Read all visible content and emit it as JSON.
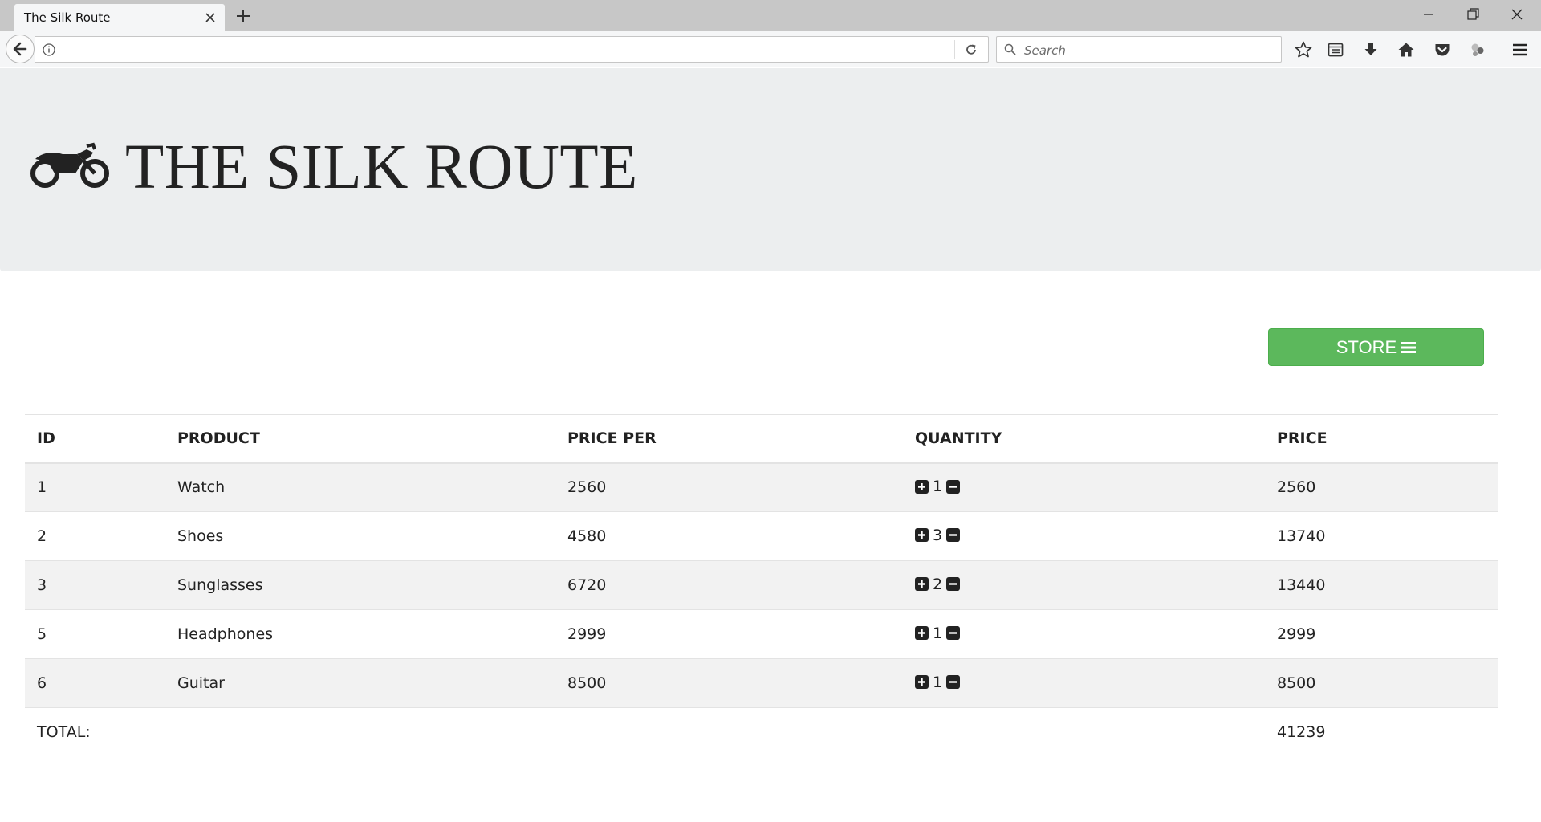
{
  "browser": {
    "tab_title": "The Silk Route",
    "url": "",
    "search_placeholder": "Search"
  },
  "header": {
    "brand_icon": "motorcycle-icon",
    "title": "THE SILK ROUTE"
  },
  "store_button": {
    "label": "STORE",
    "icon": "menu-icon",
    "color": "#5cb85c"
  },
  "cart": {
    "columns": [
      "ID",
      "PRODUCT",
      "PRICE PER",
      "QUANTITY",
      "PRICE"
    ],
    "rows": [
      {
        "id": "1",
        "product": "Watch",
        "price_per": "2560",
        "quantity": "1",
        "price": "2560"
      },
      {
        "id": "2",
        "product": "Shoes",
        "price_per": "4580",
        "quantity": "3",
        "price": "13740"
      },
      {
        "id": "3",
        "product": "Sunglasses",
        "price_per": "6720",
        "quantity": "2",
        "price": "13440"
      },
      {
        "id": "5",
        "product": "Headphones",
        "price_per": "2999",
        "quantity": "1",
        "price": "2999"
      },
      {
        "id": "6",
        "product": "Guitar",
        "price_per": "8500",
        "quantity": "1",
        "price": "8500"
      }
    ],
    "total_label": "TOTAL:",
    "total_value": "41239"
  }
}
